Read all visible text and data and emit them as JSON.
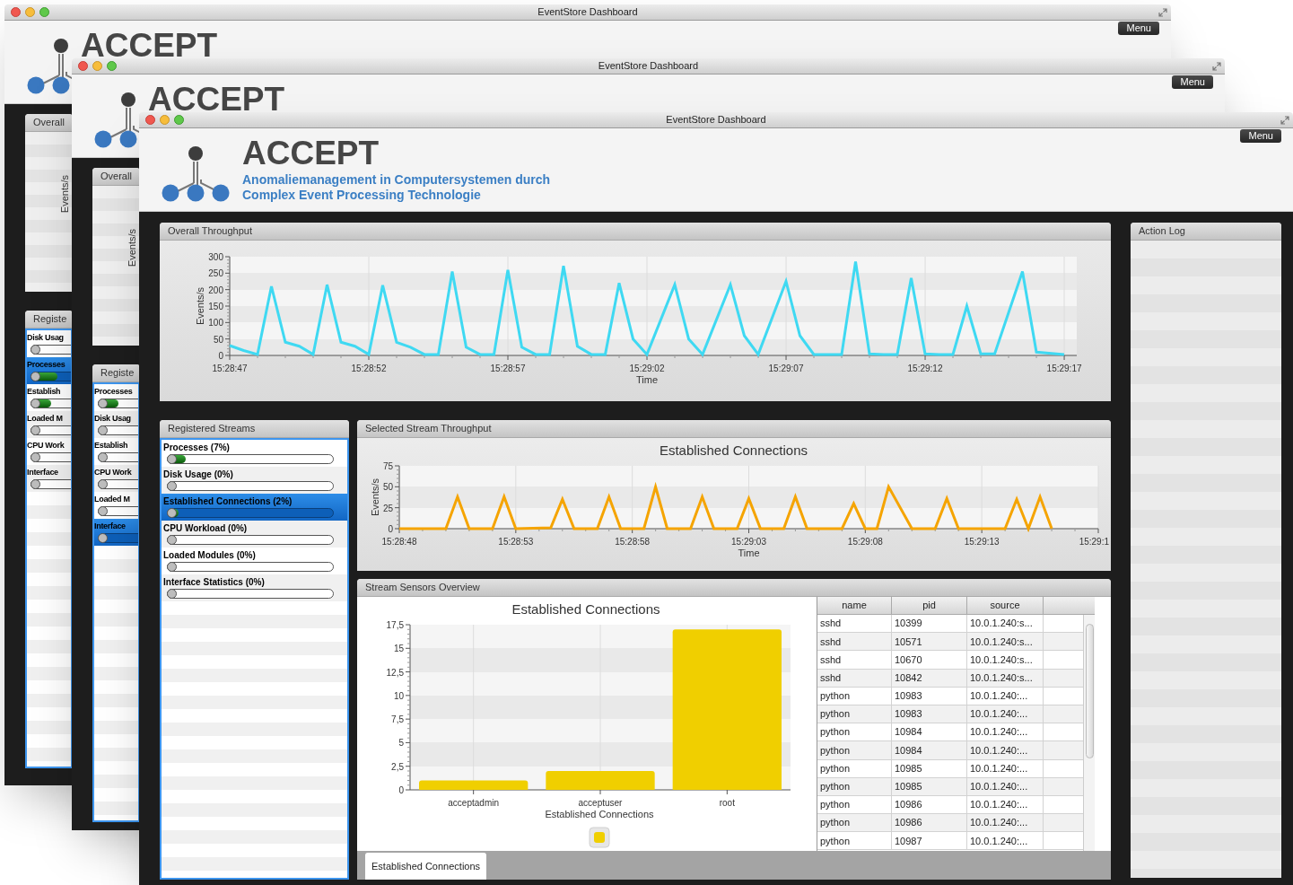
{
  "windows": [
    {
      "kind": "back",
      "title": "EventStore Dashboard",
      "menu": "Menu",
      "brand": "ACCEPT",
      "overall_panel": {
        "title": "Overall",
        "ylabel": "Events/s"
      },
      "streams_panel": {
        "title": "Registe",
        "items": [
          {
            "label": "Disk Usag",
            "selected": false,
            "level": 0
          },
          {
            "label": "Processes",
            "selected": true,
            "level": 0.12
          },
          {
            "label": "Establish",
            "selected": false,
            "level": 0.08
          },
          {
            "label": "Loaded M",
            "selected": false,
            "level": 0
          },
          {
            "label": "CPU Work",
            "selected": false,
            "level": 0
          },
          {
            "label": "Interface",
            "selected": false,
            "level": 0
          }
        ]
      }
    },
    {
      "kind": "back",
      "title": "EventStore Dashboard",
      "menu": "Menu",
      "brand": "ACCEPT",
      "overall_panel": {
        "title": "Overall",
        "ylabel": "Events/s"
      },
      "streams_panel": {
        "title": "Registe",
        "items": [
          {
            "label": "Processes",
            "selected": false,
            "level": 0.08
          },
          {
            "label": "Disk Usag",
            "selected": false,
            "level": 0
          },
          {
            "label": "Establish",
            "selected": false,
            "level": 0
          },
          {
            "label": "CPU Work",
            "selected": false,
            "level": 0
          },
          {
            "label": "Loaded M",
            "selected": false,
            "level": 0
          },
          {
            "label": "Interface",
            "selected": true,
            "level": 0
          }
        ]
      }
    },
    {
      "kind": "front",
      "title": "EventStore Dashboard",
      "menu": "Menu",
      "brand": "ACCEPT",
      "subtitle": [
        "Anomaliemanagement in Computersystemen durch",
        "Complex Event Processing Technologie"
      ],
      "overall_throughput": {
        "title": "Overall Throughput",
        "chart_data": {
          "type": "line",
          "grid": true,
          "xlabel": "Time",
          "ylabel": "Events/s",
          "x": [
            55727,
            55727.5,
            55728,
            55728.5,
            55729,
            55729.5,
            55730,
            55730.5,
            55731,
            55731.5,
            55732,
            55732.5,
            55733,
            55733.5,
            55734,
            55734.5,
            55735,
            55735.5,
            55736,
            55736.5,
            55737,
            55737.5,
            55738,
            55738.5,
            55739,
            55739.5,
            55740,
            55740.5,
            55741,
            55741.5,
            55742,
            55743,
            55743.5,
            55744,
            55745,
            55745.5,
            55746,
            55747,
            55747.5,
            55748,
            55749,
            55749.5,
            55750,
            55750.5,
            55751,
            55751.5,
            55752,
            55752.5,
            55753,
            55753.5,
            55754,
            55754.5,
            55755.5,
            55756,
            55757
          ],
          "series": [
            {
              "color": "#3fd9f2",
              "values": [
                30,
                15,
                3,
                210,
                40,
                28,
                3,
                215,
                40,
                28,
                3,
                213,
                40,
                25,
                3,
                3,
                255,
                25,
                3,
                3,
                260,
                25,
                3,
                3,
                272,
                28,
                3,
                3,
                220,
                50,
                3,
                215,
                50,
                3,
                215,
                60,
                3,
                225,
                60,
                3,
                3,
                285,
                5,
                3,
                3,
                235,
                5,
                3,
                3,
                150,
                5,
                5,
                255,
                10,
                3
              ]
            }
          ],
          "xlim": [
            55727,
            55757.45
          ],
          "ylim": [
            0,
            300
          ],
          "yticks": [
            0,
            50,
            100,
            150,
            200,
            250,
            300
          ],
          "xticks": [
            {
              "value": 55727,
              "label": "15:28:47"
            },
            {
              "value": 55732,
              "label": "15:28:52"
            },
            {
              "value": 55737,
              "label": "15:28:57"
            },
            {
              "value": 55742,
              "label": "15:29:02"
            },
            {
              "value": 55747,
              "label": "15:29:07"
            },
            {
              "value": 55752,
              "label": "15:29:12"
            },
            {
              "value": 55757,
              "label": "15:29:17"
            }
          ]
        }
      },
      "registered_streams": {
        "title": "Registered Streams",
        "items": [
          {
            "label": "Processes (7%)",
            "selected": false,
            "level": 0.07
          },
          {
            "label": "Disk Usage (0%)",
            "selected": false,
            "level": 0
          },
          {
            "label": "Established Connections (2%)",
            "selected": true,
            "level": 0.02
          },
          {
            "label": "CPU Workload (0%)",
            "selected": false,
            "level": 0
          },
          {
            "label": "Loaded Modules (0%)",
            "selected": false,
            "level": 0
          },
          {
            "label": "Interface Statistics (0%)",
            "selected": false,
            "level": 0
          }
        ]
      },
      "selected_stream_throughput": {
        "title": "Selected Stream Throughput",
        "chart_data": {
          "type": "line",
          "grid": true,
          "title": "Established Connections",
          "xlabel": "Time",
          "ylabel": "Events/s",
          "x": [
            55728,
            55730,
            55730.5,
            55731,
            55732,
            55732.5,
            55733,
            55734.5,
            55735,
            55735.5,
            55736.5,
            55737,
            55737.5,
            55738.5,
            55739,
            55739.5,
            55740.5,
            55741,
            55741.5,
            55742.5,
            55743,
            55743.5,
            55744.5,
            55745,
            55745.5,
            55747,
            55747.5,
            55748,
            55748.5,
            55749,
            55750,
            55751,
            55751.5,
            55752,
            55753,
            55754,
            55754.5,
            55755,
            55755.5,
            55756
          ],
          "series": [
            {
              "color": "#f5a400",
              "values": [
                0,
                0,
                38,
                0,
                0,
                38,
                0,
                1,
                35,
                0,
                0,
                38,
                0,
                0,
                50,
                0,
                0,
                38,
                0,
                0,
                36,
                0,
                0,
                38,
                0,
                0,
                30,
                0,
                0,
                50,
                0,
                0,
                36,
                0,
                0,
                0,
                35,
                0,
                38,
                0
              ]
            }
          ],
          "xlim": [
            55728,
            55758
          ],
          "ylim": [
            0,
            75
          ],
          "yticks": [
            0,
            25,
            50,
            75
          ],
          "xticks": [
            {
              "value": 55728,
              "label": "15:28:48"
            },
            {
              "value": 55733,
              "label": "15:28:53"
            },
            {
              "value": 55738,
              "label": "15:28:58"
            },
            {
              "value": 55743,
              "label": "15:29:03"
            },
            {
              "value": 55748,
              "label": "15:29:08"
            },
            {
              "value": 55753,
              "label": "15:29:13"
            },
            {
              "value": 55758,
              "label": "15:29:1"
            }
          ]
        }
      },
      "stream_sensors_overview": {
        "title": "Stream Sensors Overview",
        "chart_data": {
          "type": "bar",
          "grid": true,
          "title": "Established Connections",
          "xlabel": "Established Connections",
          "categories": [
            "acceptadmin",
            "acceptuser",
            "root"
          ],
          "series": [
            {
              "color": "#f0cf00",
              "values": [
                1,
                2,
                17
              ]
            }
          ],
          "ylim": [
            0,
            17.5
          ],
          "yticks": [
            {
              "value": 0,
              "label": "0"
            },
            {
              "value": 2.5,
              "label": "2,5"
            },
            {
              "value": 5,
              "label": "5"
            },
            {
              "value": 7.5,
              "label": "7,5"
            },
            {
              "value": 10,
              "label": "10"
            },
            {
              "value": 12.5,
              "label": "12,5"
            },
            {
              "value": 15,
              "label": "15"
            },
            {
              "value": 17.5,
              "label": "17,5"
            }
          ]
        },
        "table": {
          "columns": [
            "name",
            "pid",
            "source"
          ],
          "rows": [
            [
              "sshd",
              "10399",
              "10.0.1.240:s..."
            ],
            [
              "sshd",
              "10571",
              "10.0.1.240:s..."
            ],
            [
              "sshd",
              "10670",
              "10.0.1.240:s..."
            ],
            [
              "sshd",
              "10842",
              "10.0.1.240:s..."
            ],
            [
              "python",
              "10983",
              "10.0.1.240:..."
            ],
            [
              "python",
              "10983",
              "10.0.1.240:..."
            ],
            [
              "python",
              "10984",
              "10.0.1.240:..."
            ],
            [
              "python",
              "10984",
              "10.0.1.240:..."
            ],
            [
              "python",
              "10985",
              "10.0.1.240:..."
            ],
            [
              "python",
              "10985",
              "10.0.1.240:..."
            ],
            [
              "python",
              "10986",
              "10.0.1.240:..."
            ],
            [
              "python",
              "10986",
              "10.0.1.240:..."
            ],
            [
              "python",
              "10987",
              "10.0.1.240:..."
            ]
          ]
        },
        "tabs": [
          {
            "label": "Established Connections",
            "selected": true
          }
        ]
      },
      "action_log": {
        "title": "Action Log"
      }
    }
  ]
}
